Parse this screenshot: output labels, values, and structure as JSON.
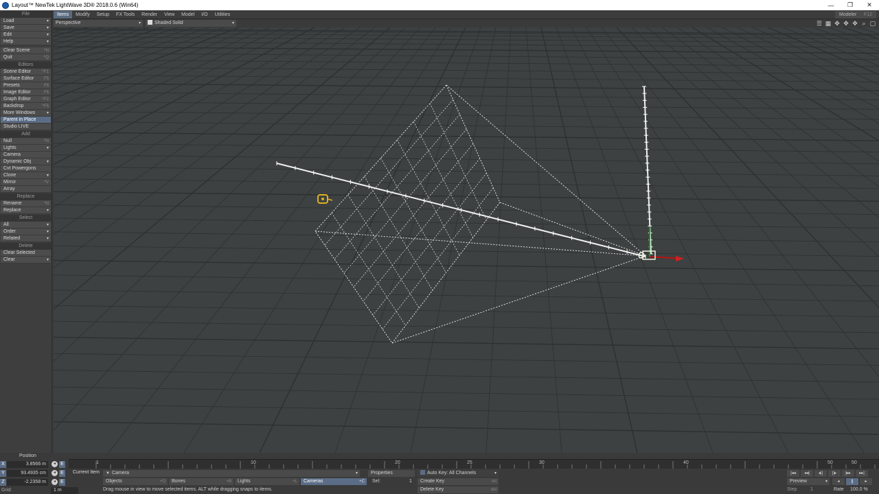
{
  "window": {
    "title": "Layout™ NewTek LightWave 3D® 2018.0.6 (Win64)",
    "min": "—",
    "restore": "❐",
    "close": "✕"
  },
  "menubar": {
    "tabs": [
      "Items",
      "Modify",
      "Setup",
      "FX Tools",
      "Render",
      "View",
      "Model",
      "I/O",
      "Utilities"
    ],
    "active_tab": "Items",
    "modeler_label": "Modeler",
    "modeler_hotkey": "F12"
  },
  "sidebar": {
    "sections": [
      {
        "title": "File",
        "items": [
          {
            "label": "Load",
            "hotkey": "",
            "dropdown": true
          },
          {
            "label": "Save",
            "hotkey": "",
            "dropdown": true
          },
          {
            "label": "Edit",
            "hotkey": "",
            "dropdown": true
          },
          {
            "label": "Help",
            "hotkey": "",
            "dropdown": true
          },
          {
            "gap": true
          },
          {
            "label": "Clear Scene",
            "hotkey": "^N"
          },
          {
            "label": "Quit",
            "hotkey": "^Q"
          }
        ]
      },
      {
        "title": "Editors",
        "items": [
          {
            "label": "Scene Editor",
            "hotkey": "^F1"
          },
          {
            "label": "Surface Editor",
            "hotkey": "F5"
          },
          {
            "label": "Presets",
            "hotkey": "F8"
          },
          {
            "label": "Image Editor",
            "hotkey": "F6"
          },
          {
            "label": "Graph Editor",
            "hotkey": "^F2"
          },
          {
            "label": "Backdrop",
            "hotkey": "^F5"
          },
          {
            "label": "More Windows",
            "hotkey": "",
            "dropdown": true
          },
          {
            "label": "Parent in Place",
            "hotkey": "",
            "highlight": true
          },
          {
            "label": "Studio LIVE",
            "hotkey": ""
          }
        ]
      },
      {
        "title": "Add",
        "items": [
          {
            "label": "Null",
            "hotkey": "^N"
          },
          {
            "label": "Lights",
            "hotkey": "",
            "dropdown": true
          },
          {
            "label": "Camera",
            "hotkey": ""
          },
          {
            "label": "Dynamic Obj",
            "hotkey": "",
            "dropdown": true
          },
          {
            "label": "Cvt Powergons",
            "hotkey": ""
          },
          {
            "label": "Clone",
            "hotkey": "",
            "dropdown": true
          },
          {
            "label": "Mirror",
            "hotkey": "^V"
          },
          {
            "label": "Array",
            "hotkey": ""
          }
        ]
      },
      {
        "title": "Replace",
        "items": [
          {
            "label": "Rename",
            "hotkey": "^N"
          },
          {
            "label": "Replace",
            "hotkey": "",
            "dropdown": true
          }
        ]
      },
      {
        "title": "Select",
        "items": [
          {
            "label": "All",
            "hotkey": "",
            "dropdown": true
          },
          {
            "label": "Order",
            "hotkey": "",
            "dropdown": true
          },
          {
            "label": "Related",
            "hotkey": "",
            "dropdown": true
          }
        ]
      },
      {
        "title": "Delete",
        "items": [
          {
            "label": "Clear Selected",
            "hotkey": ""
          },
          {
            "label": "Clear",
            "hotkey": "",
            "dropdown": true
          }
        ]
      }
    ]
  },
  "viewport_toolbar": {
    "view_mode": "Perspective",
    "shading": "Shaded Solid"
  },
  "bottom": {
    "position_label": "Position",
    "coords": [
      {
        "axis": "X",
        "value": "3.8566 m"
      },
      {
        "axis": "Y",
        "value": "93.4935 cm"
      },
      {
        "axis": "Z",
        "value": "-2.2358 m"
      }
    ],
    "grid_label": "Grid:",
    "grid_value": "1 m",
    "timeline": {
      "start": "0",
      "ticks": [
        "1",
        "10",
        "20",
        "25",
        "30",
        "40",
        "50",
        "50"
      ]
    },
    "current_item_label": "Current Item",
    "current_item_value": "Camera",
    "properties_label": "Properties",
    "auto_key_label": "Auto Key: All Channels",
    "sel_label": "Sel:",
    "sel_value": "1",
    "item_types": [
      {
        "label": "Objects",
        "hotkey": "+O"
      },
      {
        "label": "Bones",
        "hotkey": "+B"
      },
      {
        "label": "Lights",
        "hotkey": "+L"
      },
      {
        "label": "Cameras",
        "hotkey": "+C"
      }
    ],
    "create_key_label": "Create Key",
    "create_key_hotkey": "ret",
    "delete_key_label": "Delete Key",
    "delete_key_hotkey": "del",
    "preview_label": "Preview",
    "step_label": "Step",
    "step_value": "1",
    "rate_label": "Rate",
    "rate_value": "100.0 %",
    "status": "Drag mouse in view to move selected items. ALT while dragging snaps to items."
  },
  "colors": {
    "selected": "#5b6d86",
    "viewport_bg": "#3d4141",
    "grid_line": "#2c3030",
    "camera_line": "#e8e8e8",
    "light_icon": "#e0b020"
  }
}
